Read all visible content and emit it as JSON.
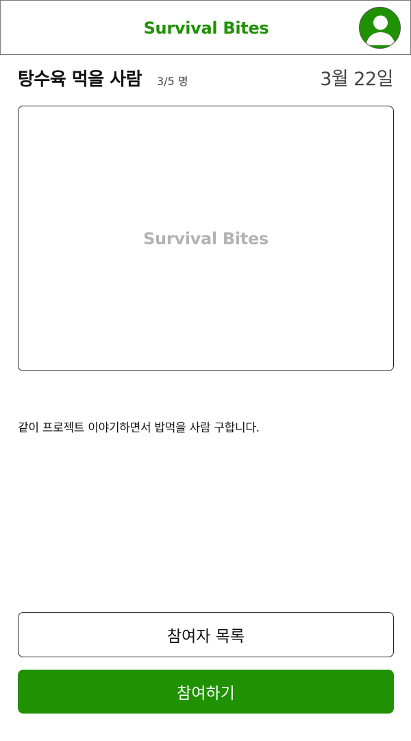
{
  "header": {
    "app_title": "Survival Bites",
    "avatar_icon": "user-avatar-icon"
  },
  "post": {
    "title": "탕수육 먹을 사람",
    "headcount": "3/5 명",
    "date": "3월 22일",
    "image_placeholder_text": "Survival Bites",
    "description": "같이 프로젝트 이야기하면서 밥먹을 사람 구합니다."
  },
  "actions": {
    "participants_label": "참여자 목록",
    "join_label": "참여하기"
  },
  "colors": {
    "brand": "#1f9102",
    "placeholder_text": "#b3b3b3"
  }
}
